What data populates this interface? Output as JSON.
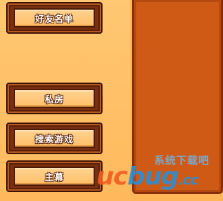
{
  "menu": {
    "friends_label": "好友名单",
    "private_room_label": "私房",
    "search_game_label": "搜索游戏",
    "main_menu_label": "主幕"
  },
  "watermark": {
    "site_name_cn": "系统下载吧",
    "logo_uc": "uc",
    "logo_bug": "bug",
    "logo_cc": ".cc"
  },
  "colors": {
    "background": "#ffbd65",
    "button_frame": "#7a3010",
    "button_face": "#ffc878",
    "panel": "#cf5a16",
    "panel_border": "#8a2e08",
    "label_text": "#ffffff"
  }
}
